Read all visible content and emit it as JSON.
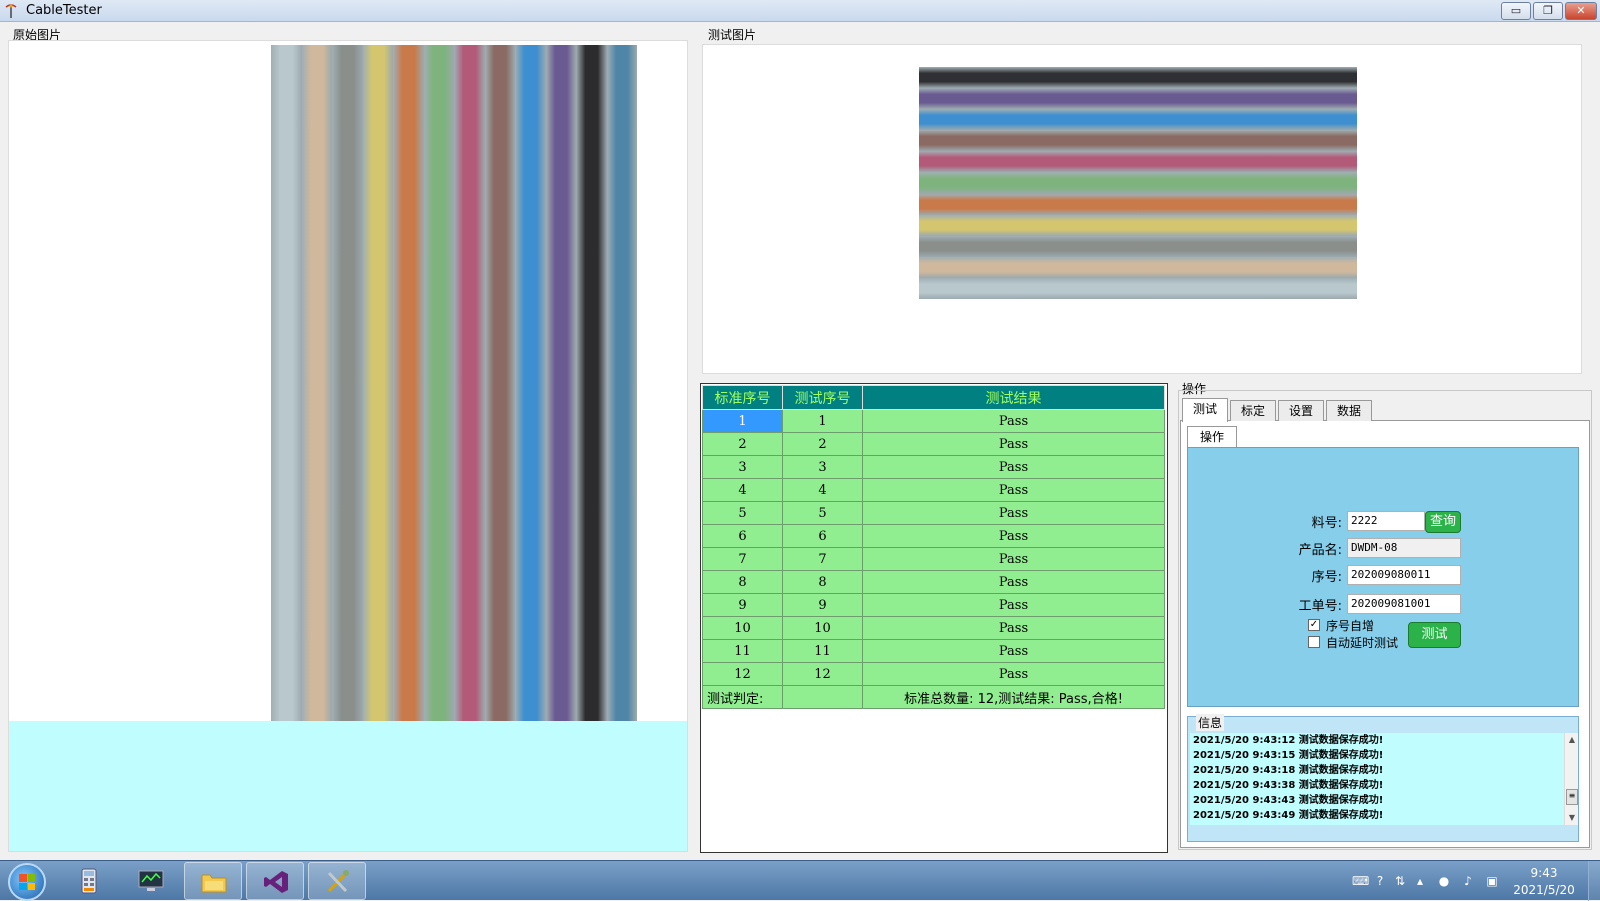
{
  "window": {
    "title": "CableTester",
    "minimize_glyph": "▭",
    "maximize_glyph": "❐",
    "close_glyph": "✕"
  },
  "panels": {
    "original_label": "原始图片",
    "test_label": "测试图片"
  },
  "colors": {
    "table_header_bg": "#008080",
    "table_header_text": "#a0ff60",
    "row_pass_bg": "#90ee90",
    "selected_cell_bg": "#3399ff",
    "ops_panel_bg": "#87ceeb",
    "button_green": "#2bb34a"
  },
  "cable_colors_vertical": [
    "#b9c8cc",
    "#d0b89c",
    "#8a8f8c",
    "#d4c66e",
    "#c97a4a",
    "#7fb37d",
    "#b35a78",
    "#8a6a62",
    "#3d8fcf",
    "#6a5a92",
    "#2c2c2e",
    "#4f86a8"
  ],
  "cable_colors_horizontal": [
    "#2f3033",
    "#6a5a92",
    "#3d8fcf",
    "#8a6a62",
    "#b35a78",
    "#7fb37d",
    "#c97a4a",
    "#d4c66e",
    "#8a8f8c",
    "#d0b89c",
    "#b9c8cc"
  ],
  "table": {
    "headers": [
      "标准序号",
      "测试序号",
      "测试结果"
    ],
    "rows": [
      [
        "1",
        "1",
        "Pass"
      ],
      [
        "2",
        "2",
        "Pass"
      ],
      [
        "3",
        "3",
        "Pass"
      ],
      [
        "4",
        "4",
        "Pass"
      ],
      [
        "5",
        "5",
        "Pass"
      ],
      [
        "6",
        "6",
        "Pass"
      ],
      [
        "7",
        "7",
        "Pass"
      ],
      [
        "8",
        "8",
        "Pass"
      ],
      [
        "9",
        "9",
        "Pass"
      ],
      [
        "10",
        "10",
        "Pass"
      ],
      [
        "11",
        "11",
        "Pass"
      ],
      [
        "12",
        "12",
        "Pass"
      ]
    ],
    "footer_label": "测试判定:",
    "footer_result": "标准总数量: 12,测试结果: Pass,合格!"
  },
  "ops": {
    "group_label": "操作",
    "tabs": [
      "测试",
      "标定",
      "设置",
      "数据"
    ],
    "subtab": "操作",
    "part_no_label": "料号:",
    "part_no_value": "2222",
    "query_button": "查询",
    "product_name_label": "产品名:",
    "product_name_value": "DWDM-08",
    "serial_label": "序号:",
    "serial_value": "202009080011",
    "work_order_label": "工单号:",
    "work_order_value": "202009081001",
    "auto_increment_label": "序号自增",
    "auto_increment_checked": true,
    "auto_delay_label": "自动延时测试",
    "auto_delay_checked": false,
    "test_button": "测试"
  },
  "info": {
    "label": "信息",
    "log": [
      "2021/5/20 9:43:12 测试数据保存成功!",
      "2021/5/20 9:43:15 测试数据保存成功!",
      "2021/5/20 9:43:18 测试数据保存成功!",
      "2021/5/20 9:43:38 测试数据保存成功!",
      "2021/5/20 9:43:43 测试数据保存成功!",
      "2021/5/20 9:43:49 测试数据保存成功!"
    ]
  },
  "taskbar": {
    "time": "9:43",
    "date": "2021/5/20",
    "items": [
      "calculator-icon",
      "monitor-app-icon",
      "file-explorer-icon",
      "visual-studio-icon",
      "tools-icon"
    ]
  }
}
